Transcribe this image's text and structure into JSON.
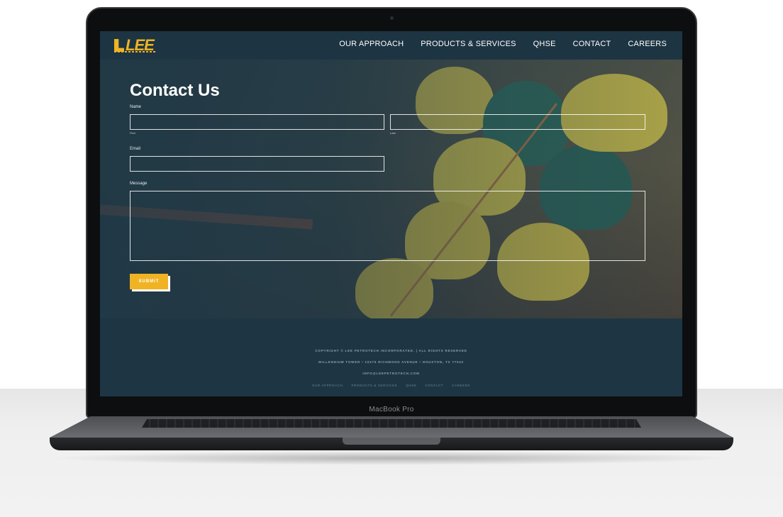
{
  "device": {
    "model_label": "MacBook Pro"
  },
  "site": {
    "logo": {
      "text": "LEE",
      "sub": "PETROTECH"
    },
    "nav": [
      {
        "label": "OUR APPROACH"
      },
      {
        "label": "PRODUCTS & SERVICES"
      },
      {
        "label": "QHSE"
      },
      {
        "label": "CONTACT"
      },
      {
        "label": "CAREERS"
      }
    ],
    "form": {
      "title": "Contact Us",
      "name_label": "Name",
      "first_label": "First",
      "last_label": "Last",
      "email_label": "Email",
      "message_label": "Message",
      "submit_label": "SUBMIT"
    },
    "footer": {
      "copyright": "COPYRIGHT © LEE PETROTECH INCORPORATED. | ALL RIGHTS RESERVED",
      "address": "MILLENNIUM TOWER • 10375 RICHMOND AVENUE • HOUSTON, TX 77042",
      "email": "INFO@LEEPETROTECH.COM",
      "links": [
        {
          "label": "OUR APPROACH"
        },
        {
          "label": "PRODUCTS & SERVICES"
        },
        {
          "label": "QHSE"
        },
        {
          "label": "CONTACT"
        },
        {
          "label": "CAREERS"
        }
      ]
    },
    "colors": {
      "accent": "#f0b323",
      "nav_bg": "#1d3442",
      "footer_bg": "#1e3644"
    }
  }
}
